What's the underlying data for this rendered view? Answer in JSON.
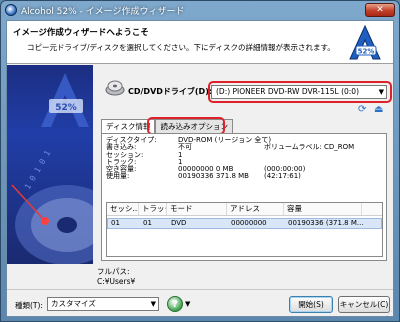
{
  "window": {
    "title": "Alcohol 52% - イメージ作成ウィザード",
    "close_label": "✕"
  },
  "header": {
    "title": "イメージ作成ウィザードへようこそ",
    "description": "コピー元ドライブ/ディスクを選択してください。下にディスクの詳細情報が表示されます。",
    "logo_text": "52%"
  },
  "sidebar": {
    "logo_text": "52%",
    "decor_digits": "1 0 1 0 1"
  },
  "drive": {
    "label": "CD/DVDドライブ(D):",
    "selected": "(D:) PIONEER DVD-RW  DVR-115L (0:0)"
  },
  "tabs": [
    {
      "label": "ディスク情報"
    },
    {
      "label": "読み込みオプション"
    }
  ],
  "disc_info": [
    {
      "key": "ディスクタイプ:",
      "value": "DVD-ROM (リージョン 全て)",
      "extra": ""
    },
    {
      "key": "書き込み:",
      "value": "不可",
      "extra": "ボリュームラベル: CD_ROM"
    },
    {
      "key": "セッション:",
      "value": "1",
      "extra": ""
    },
    {
      "key": "トラック:",
      "value": "1",
      "extra": ""
    },
    {
      "key": "空き容量:",
      "value": "00000000    0 MB",
      "extra": "(000:00:00)"
    },
    {
      "key": "使用量:",
      "value": "00190336    371.8 MB",
      "extra": "(42:17:61)"
    }
  ],
  "track_table": {
    "headers": [
      "セッシ...",
      "トラック",
      "モード",
      "アドレス",
      "容量"
    ],
    "rows": [
      [
        "01",
        "01",
        "DVD",
        "00000000",
        "00190336 (371.8 M..."
      ]
    ]
  },
  "footer": {
    "path_label": "フルパス:",
    "path_value": "C:¥Users¥"
  },
  "bottom": {
    "type_label": "種類(T):",
    "type_value": "カスタマイズ",
    "start_button": "開始(S)",
    "cancel_button": "キャンセル(C)"
  },
  "colors": {
    "highlight": "#e0202a",
    "sidebar": "#213ea8",
    "titlebar": "#6f9bc2"
  }
}
